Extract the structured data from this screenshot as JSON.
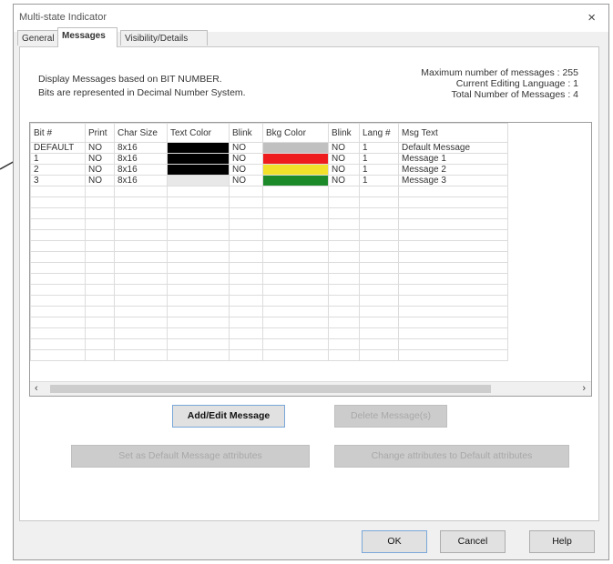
{
  "window": {
    "title": "Multi-state Indicator",
    "close_glyph": "×"
  },
  "tabs": [
    {
      "label": "General",
      "active": false
    },
    {
      "label": "Messages",
      "active": true
    },
    {
      "label": "Visibility/Details",
      "active": false
    }
  ],
  "info": {
    "line1": "Display Messages based on BIT NUMBER.",
    "line2": "Bits are represented in Decimal Number System.",
    "max_messages": "Maximum number of messages : 255",
    "current_language": "Current Editing Language : 1",
    "total_messages": "Total Number of Messages : 4"
  },
  "table": {
    "columns": [
      "Bit #",
      "Print",
      "Char Size",
      "Text Color",
      "Blink",
      "Bkg Color",
      "Blink",
      "Lang #",
      "Msg Text"
    ],
    "rows": [
      {
        "bit": "DEFAULT",
        "print": "NO",
        "char_size": "8x16",
        "text_color": "#000000",
        "blink": "NO",
        "bkg_color": "#c0c0c0",
        "blink2": "NO",
        "lang": "1",
        "msg": "Default Message"
      },
      {
        "bit": "1",
        "print": "NO",
        "char_size": "8x16",
        "text_color": "#000000",
        "blink": "NO",
        "bkg_color": "#ee1c1c",
        "blink2": "NO",
        "lang": "1",
        "msg": "Message 1"
      },
      {
        "bit": "2",
        "print": "NO",
        "char_size": "8x16",
        "text_color": "#000000",
        "blink": "NO",
        "bkg_color": "#f2e12a",
        "blink2": "NO",
        "lang": "1",
        "msg": "Message 2"
      },
      {
        "bit": "3",
        "print": "NO",
        "char_size": "8x16",
        "text_color": "#e8e8e8",
        "blink": "NO",
        "bkg_color": "#1d8a2a",
        "blink2": "NO",
        "lang": "1",
        "msg": "Message 3"
      }
    ]
  },
  "scrollbar": {
    "left_glyph": "‹",
    "right_glyph": "›"
  },
  "buttons": {
    "add_edit": "Add/Edit Message",
    "delete": "Delete Message(s)",
    "set_default": "Set as Default Message attributes",
    "change_default": "Change attributes to Default attributes",
    "ok": "OK",
    "cancel": "Cancel",
    "help": "Help"
  }
}
